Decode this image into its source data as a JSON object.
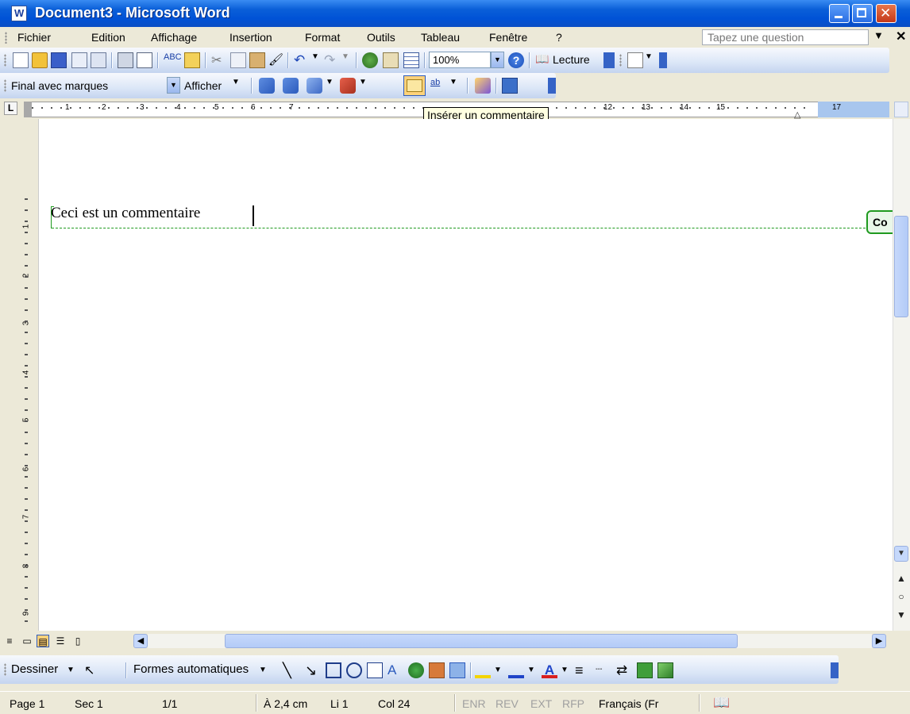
{
  "window": {
    "title": "Document3 - Microsoft Word"
  },
  "menubar": {
    "items": [
      "Fichier",
      "Edition",
      "Affichage",
      "Insertion",
      "Format",
      "Outils",
      "Tableau",
      "Fenêtre",
      "?"
    ],
    "question_placeholder": "Tapez une question"
  },
  "standard_toolbar": {
    "zoom": "100%",
    "reading_label": "Lecture",
    "icons": [
      "new-icon",
      "open-icon",
      "save-icon",
      "permission-icon",
      "email-icon",
      "print-icon",
      "print-preview-icon",
      "spelling-icon",
      "research-icon",
      "cut-icon",
      "copy-icon",
      "paste-icon",
      "format-painter-icon",
      "undo-icon",
      "redo-icon",
      "hyperlink-icon",
      "tables-borders-icon",
      "insert-table-icon",
      "help-icon",
      "read-icon"
    ]
  },
  "reviewing_toolbar": {
    "display_mode": "Final avec marques",
    "show_label": "Afficher"
  },
  "tooltip": "Insérer un commentaire",
  "ruler": {
    "numbers": [
      "1",
      "2",
      "3",
      "4",
      "5",
      "6",
      "7",
      "12",
      "13",
      "14",
      "15",
      "17"
    ],
    "corner": "L"
  },
  "vertical_ruler": {
    "numbers": [
      "1",
      "2",
      "3",
      "4",
      "5",
      "6",
      "7",
      "8",
      "9"
    ]
  },
  "document": {
    "text": "Ceci est un commentaire",
    "balloon_label": "Co"
  },
  "drawing_toolbar": {
    "draw_label": "Dessiner",
    "autoshapes_label": "Formes automatiques"
  },
  "statusbar": {
    "page": "Page 1",
    "section": "Sec 1",
    "pages": "1/1",
    "position": "À 2,4 cm",
    "line": "Li 1",
    "column": "Col 24",
    "enr": "ENR",
    "rev": "REV",
    "ext": "EXT",
    "rfp": "RFP",
    "language": "Français (Fr"
  },
  "colors": {
    "titlebar": "#0a5fd8",
    "comment": "#1f9a1f",
    "tooltip_bg": "#ffffe1"
  }
}
